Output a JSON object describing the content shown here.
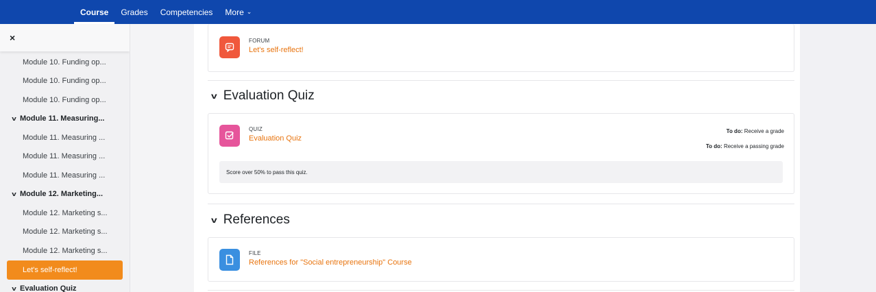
{
  "nav": {
    "tabs": [
      {
        "label": "Course",
        "active": true
      },
      {
        "label": "Grades"
      },
      {
        "label": "Competencies"
      },
      {
        "label": "More",
        "dropdown": true
      }
    ],
    "caret": "⌄",
    "background": "#0f47ad"
  },
  "drawer": {
    "close_icon": "×",
    "items": [
      {
        "label": "Module 10. Funding op...",
        "kind": "item"
      },
      {
        "label": "Module 10. Funding op...",
        "kind": "item"
      },
      {
        "label": "Module 10. Funding op...",
        "kind": "item"
      },
      {
        "label": "Module 11. Measuring...",
        "kind": "section"
      },
      {
        "label": "Module 11. Measuring ...",
        "kind": "item"
      },
      {
        "label": "Module 11. Measuring ...",
        "kind": "item"
      },
      {
        "label": "Module 11. Measuring ...",
        "kind": "item"
      },
      {
        "label": "Module 12. Marketing...",
        "kind": "section"
      },
      {
        "label": "Module 12. Marketing s...",
        "kind": "item"
      },
      {
        "label": "Module 12. Marketing s...",
        "kind": "item"
      },
      {
        "label": "Module 12. Marketing s...",
        "kind": "item"
      },
      {
        "label": "Let's self-reflect!",
        "kind": "active"
      },
      {
        "label": "Evaluation Quiz",
        "kind": "section"
      }
    ]
  },
  "content": {
    "forum": {
      "type": "FORUM",
      "name": "Let's self-reflect!",
      "icon": "forum-icon",
      "color": "#f0583c"
    },
    "quiz_section": {
      "title": "Evaluation Quiz"
    },
    "quiz": {
      "type": "QUIZ",
      "name": "Evaluation Quiz",
      "icon": "quiz-icon",
      "color": "#e6559b",
      "todo_label": "To do:",
      "todo1": "Receive a grade",
      "todo2": "Receive a passing grade",
      "notice": "Score over 50% to pass this quiz."
    },
    "refs_section": {
      "title": "References"
    },
    "file": {
      "type": "FILE",
      "name": "References for \"Social entrepreneurship\" Course",
      "icon": "file-icon",
      "color": "#3a8fe0"
    }
  },
  "accent": "#e8740f"
}
